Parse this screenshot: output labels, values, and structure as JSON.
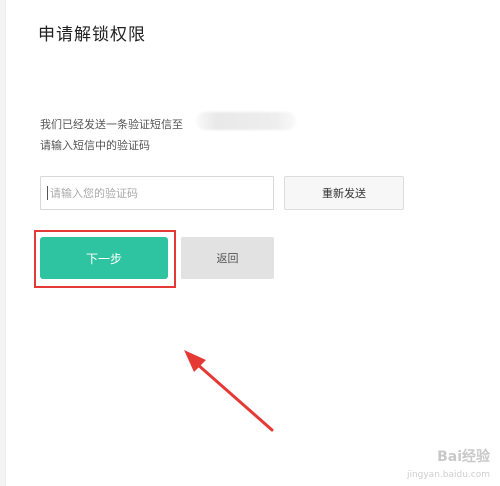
{
  "page": {
    "title": "申请解锁权限",
    "info_line1": "我们已经发送一条验证短信至",
    "info_line2": "请输入短信中的验证码"
  },
  "form": {
    "code_placeholder": "请输入您的验证码",
    "code_value": "",
    "resend_label": "重新发送",
    "next_label": "下一步",
    "back_label": "返回"
  },
  "colors": {
    "primary": "#2ec4a1",
    "highlight": "#e53935",
    "back_button": "#e2e2e2"
  },
  "watermark": {
    "main": "Bai经验",
    "sub": "jingyan.baidu.com"
  }
}
